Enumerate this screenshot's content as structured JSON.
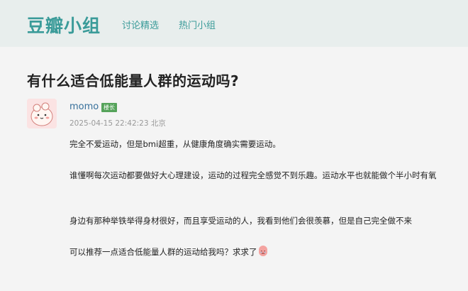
{
  "header": {
    "logo": "豆瓣小组",
    "nav": [
      "讨论精选",
      "热门小组"
    ]
  },
  "post": {
    "title": "有什么适合低能量人群的运动吗?",
    "author": "momo",
    "badge": "楼长",
    "meta": "2025-04-15 22:42:23 北京",
    "paragraphs": [
      "完全不爱运动，但是bmi超重，从健康角度确实需要运动。",
      "谁懂啊每次运动都要做好大心理建设，运动的过程完全感觉不到乐趣。运动水平也就能做个半小时有氧",
      "身边有那种举铁举得身材很好，而且享受运动的人，我看到他们会很羡慕，但是自己完全做不来",
      "可以推荐一点适合低能量人群的运动给我吗？求求了"
    ],
    "emoji_icon": "crying-face-icon"
  }
}
